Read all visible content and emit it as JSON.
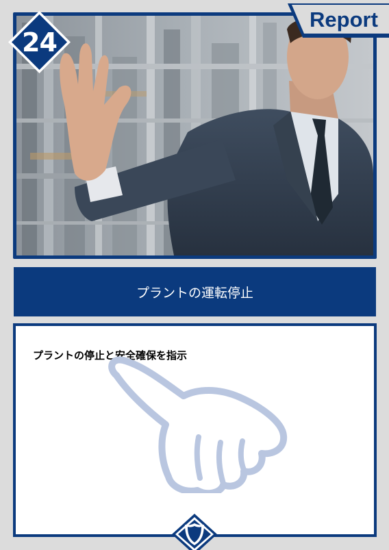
{
  "card": {
    "number": "24",
    "category_label": "Report",
    "title": "プラントの運転停止",
    "description": "プラントの停止と安全確保を指示"
  },
  "colors": {
    "navy": "#0b3a7e",
    "background": "#dcdcdc",
    "hand_outline": "#b9c6e0",
    "white": "#ffffff"
  },
  "icons": {
    "badge": "diamond-badge",
    "pointing": "pointing-hand-icon",
    "emblem": "shield-icon"
  }
}
